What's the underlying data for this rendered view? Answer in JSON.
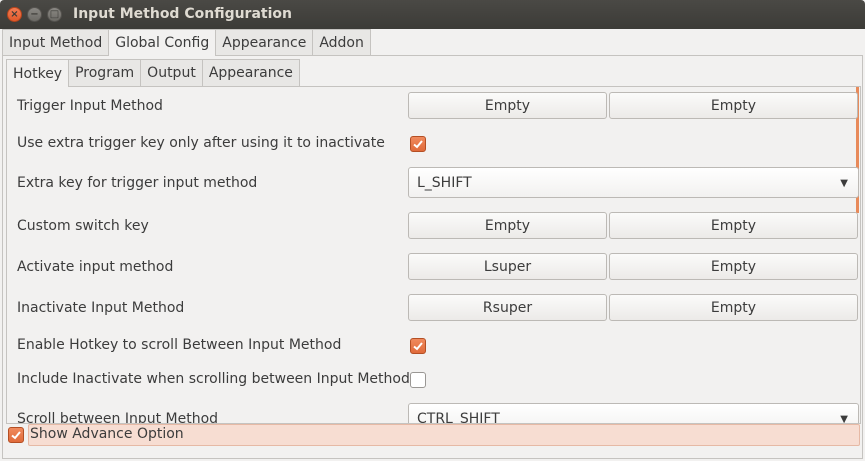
{
  "window": {
    "title": "Input Method Configuration",
    "close_glyph": "×",
    "min_glyph": "−",
    "max_glyph": "□"
  },
  "outer_tabs": [
    "Input Method",
    "Global Config",
    "Appearance",
    "Addon"
  ],
  "inner_tabs": [
    "Hotkey",
    "Program",
    "Output",
    "Appearance"
  ],
  "settings": {
    "trigger": {
      "label": "Trigger Input Method",
      "key1": "Empty",
      "key2": "Empty"
    },
    "extra_only": {
      "label": "Use extra trigger key only after using it to inactivate",
      "checked": true
    },
    "extra_key": {
      "label": "Extra key for trigger input method",
      "value": "L_SHIFT"
    },
    "custom_switch": {
      "label": "Custom switch key",
      "key1": "Empty",
      "key2": "Empty"
    },
    "activate": {
      "label": "Activate input method",
      "key1": "Lsuper",
      "key2": "Empty"
    },
    "inactivate": {
      "label": "Inactivate Input Method",
      "key1": "Rsuper",
      "key2": "Empty"
    },
    "enable_scroll": {
      "label": "Enable Hotkey to scroll Between Input Method",
      "checked": true
    },
    "include_inactivate": {
      "label": "Include Inactivate when scrolling between Input Method",
      "checked": false
    },
    "scroll_between": {
      "label": "Scroll between Input Method",
      "value": "CTRL_SHIFT"
    }
  },
  "advance_option": {
    "label": "Show Advance Option",
    "checked": true
  },
  "colors": {
    "accent": "#e06a3a",
    "titlebar": "#3c3b37"
  }
}
